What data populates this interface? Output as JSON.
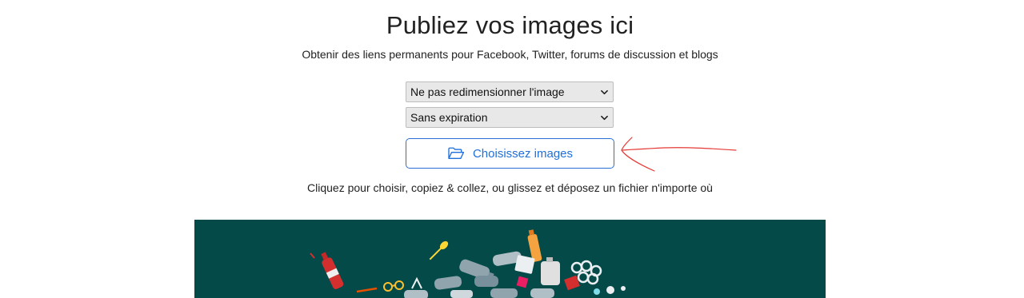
{
  "header": {
    "title": "Publiez vos images ici",
    "subtitle": "Obtenir des liens permanents pour Facebook, Twitter, forums de discussion et blogs"
  },
  "form": {
    "resize_select": {
      "selected": "Ne pas redimensionner l'image"
    },
    "expiration_select": {
      "selected": "Sans expiration"
    },
    "choose_button_label": "Choisissez images",
    "hint": "Cliquez pour choisir, copiez & collez, ou glissez et déposez un fichier n'importe où"
  },
  "icons": {
    "folder": "folder-open-icon",
    "chevron": "chevron-down-icon"
  },
  "colors": {
    "accent": "#1e6fdc",
    "banner_bg": "#044a48",
    "annotation": "#e53935"
  }
}
